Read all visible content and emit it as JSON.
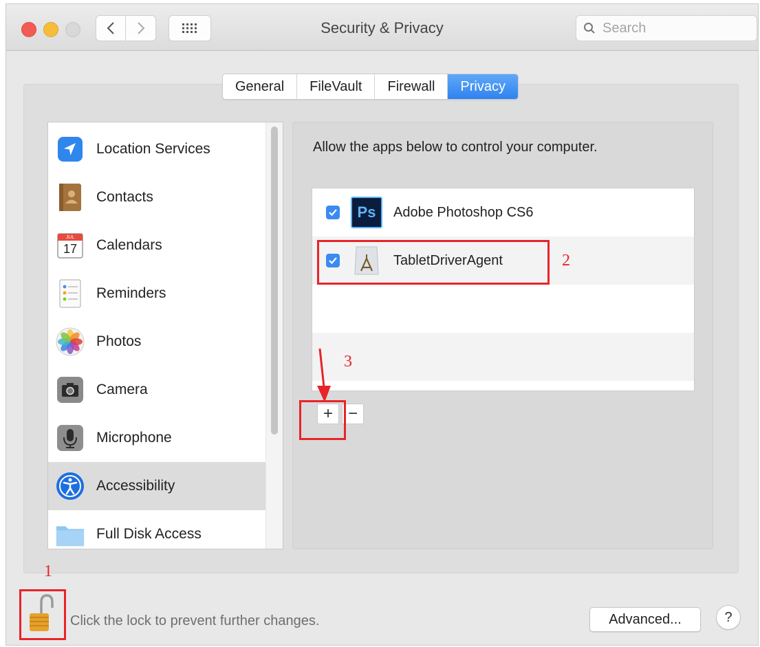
{
  "window": {
    "title": "Security & Privacy",
    "search_placeholder": "Search"
  },
  "tabs": [
    {
      "label": "General"
    },
    {
      "label": "FileVault"
    },
    {
      "label": "Firewall"
    },
    {
      "label": "Privacy",
      "active": true
    }
  ],
  "sidebar": {
    "items": [
      {
        "label": "Location Services",
        "icon": "location-arrow-icon"
      },
      {
        "label": "Contacts",
        "icon": "contacts-book-icon"
      },
      {
        "label": "Calendars",
        "icon": "calendar-icon",
        "icon_day": "17",
        "icon_month": "JUL"
      },
      {
        "label": "Reminders",
        "icon": "reminders-list-icon"
      },
      {
        "label": "Photos",
        "icon": "photos-flower-icon"
      },
      {
        "label": "Camera",
        "icon": "camera-icon"
      },
      {
        "label": "Microphone",
        "icon": "microphone-icon"
      },
      {
        "label": "Accessibility",
        "icon": "accessibility-icon",
        "selected": true
      },
      {
        "label": "Full Disk Access",
        "icon": "folder-icon"
      }
    ]
  },
  "privacy": {
    "description": "Allow the apps below to control your computer.",
    "apps": [
      {
        "name": "Adobe Photoshop CS6",
        "checked": true,
        "icon": "photoshop-icon",
        "icon_text": "Ps"
      },
      {
        "name": "TabletDriverAgent",
        "checked": true,
        "icon": "app-generic-icon"
      }
    ],
    "add_label": "+",
    "remove_label": "−"
  },
  "footer": {
    "lock_message": "Click the lock to prevent further changes.",
    "advanced_label": "Advanced...",
    "help_label": "?"
  },
  "annotations": [
    {
      "label": "1",
      "target": "lock"
    },
    {
      "label": "2",
      "target": "TabletDriverAgent row"
    },
    {
      "label": "3",
      "target": "add button"
    }
  ],
  "colors": {
    "accent": "#3b8af1",
    "annotation": "#e8232a"
  }
}
